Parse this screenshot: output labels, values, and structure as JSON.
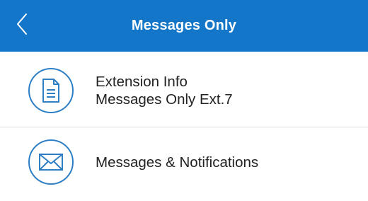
{
  "header": {
    "title": "Messages Only",
    "background_color": "#1376c8",
    "back_icon": "chevron-left-icon"
  },
  "items": [
    {
      "icon": "document-icon",
      "line1": "Extension Info",
      "line2": "Messages Only Ext.7"
    },
    {
      "icon": "envelope-icon",
      "line1": "Messages & Notifications"
    }
  ],
  "accent_color": "#2f7fc4"
}
